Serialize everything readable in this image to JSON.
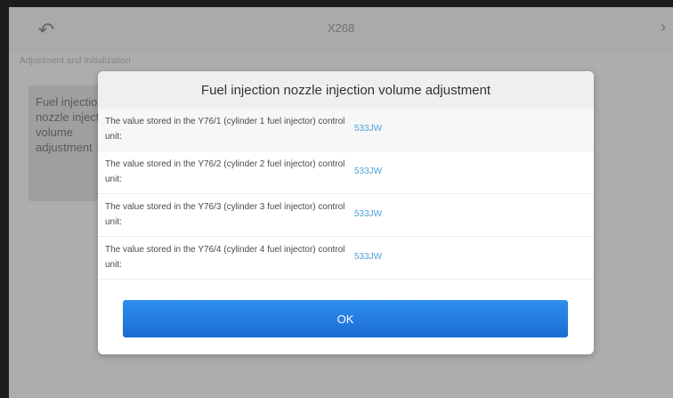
{
  "header": {
    "back_icon": "back-arrow-icon",
    "title": "X268"
  },
  "breadcrumb": "Adjustment and Initialization",
  "left_panel": {
    "text": "Fuel injection\nnozzle injection\nvolume\nadjustment"
  },
  "dialog": {
    "title": "Fuel injection nozzle injection volume adjustment",
    "rows": [
      {
        "label": "The value stored in the Y76/1 (cylinder 1 fuel injector) control unit:",
        "value": "533JW"
      },
      {
        "label": "The value stored in the Y76/2 (cylinder 2 fuel injector) control unit:",
        "value": "533JW"
      },
      {
        "label": "The value stored in the Y76/3 (cylinder 3 fuel injector) control unit:",
        "value": "533JW"
      },
      {
        "label": "The value stored in the Y76/4 (cylinder 4 fuel injector) control unit:",
        "value": "533JW"
      }
    ],
    "ok_label": "OK"
  },
  "colors": {
    "accent": "#1f78e0",
    "value_text": "#4aa3d8"
  }
}
